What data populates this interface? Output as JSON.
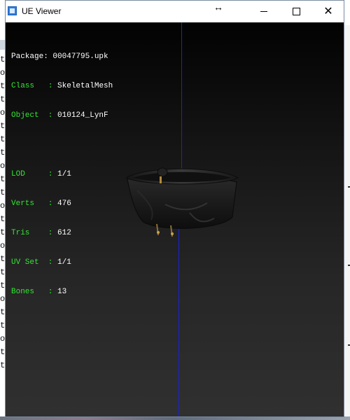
{
  "window": {
    "title": "UE Viewer",
    "resize_cursor_icon": "resize-horizontal-icon"
  },
  "background": {
    "console_letters": [
      "t",
      "o",
      "t",
      "t",
      "o",
      "t",
      "t",
      "t",
      "o",
      "t",
      "t",
      "o",
      "t",
      "t",
      "o",
      "t",
      "t",
      "t",
      "o",
      "t",
      "t",
      "o",
      "t",
      "t"
    ]
  },
  "info": {
    "package_label": "Package",
    "package_value": "00047795.upk",
    "class_label": "Class",
    "class_value": "SkeletalMesh",
    "object_label": "Object",
    "object_value": "010124_LynF",
    "lod_label": "LOD",
    "lod_value": "1/1",
    "verts_label": "Verts",
    "verts_value": "476",
    "tris_label": "Tris",
    "tris_value": "612",
    "uvset_label": "UV Set",
    "uvset_value": "1/1",
    "bones_label": "Bones",
    "bones_value": "13"
  },
  "colors": {
    "label_green": "#33e633",
    "value_white": "#ffffff",
    "axis_blue": "#1a23d6"
  }
}
